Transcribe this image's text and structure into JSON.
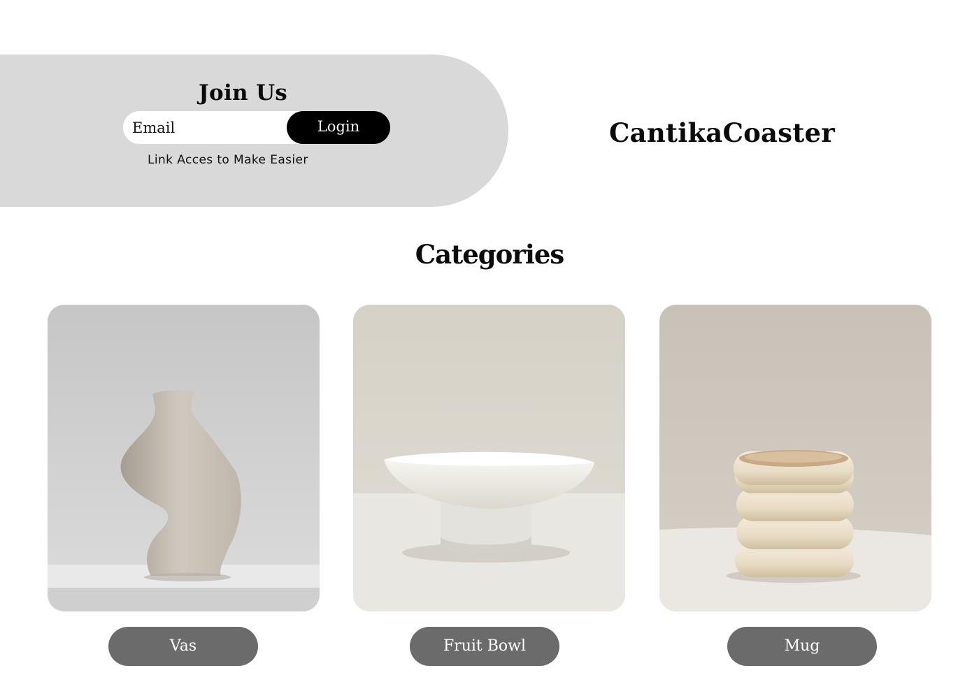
{
  "join": {
    "title": "Join Us",
    "email_placeholder": "Email",
    "login_label": "Login",
    "note": "Link Acces to Make Easier"
  },
  "brand": {
    "name": "CantikaCoaster"
  },
  "categories": {
    "title": "Categories",
    "items": [
      {
        "label": "Vas",
        "image": "sculptural-vase-photo"
      },
      {
        "label": "Fruit Bowl",
        "image": "pedestal-fruit-bowl-photo"
      },
      {
        "label": "Mug",
        "image": "stacked-ring-mug-photo"
      }
    ]
  },
  "colors": {
    "panel": "#d9d9d9",
    "login_button": "#000000",
    "category_button": "#6b6b6b",
    "text": "#0a0a0a"
  }
}
